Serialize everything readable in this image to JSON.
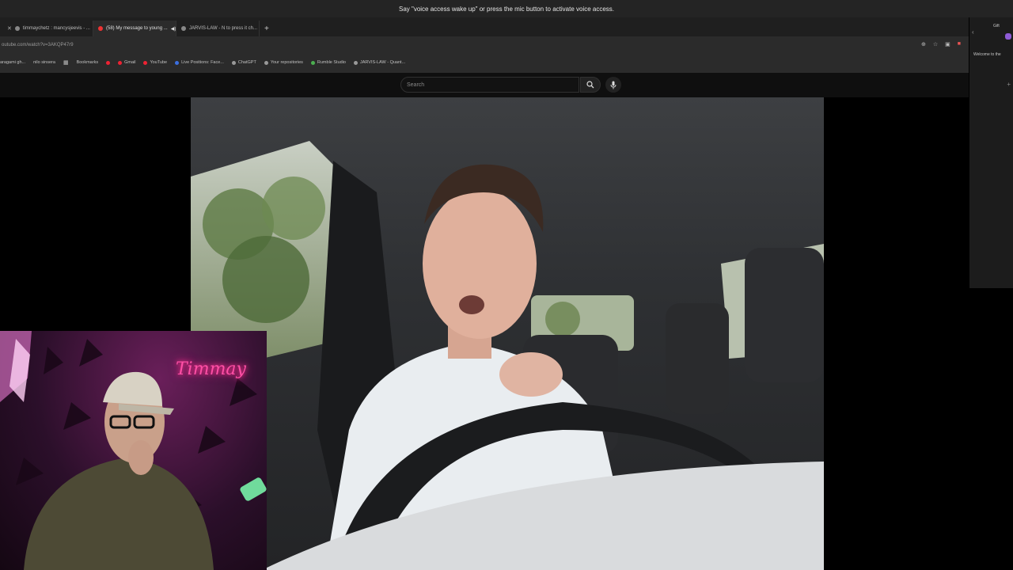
{
  "voice_access": {
    "message": "Say \"voice access wake up\" or press the mic button to activate voice access."
  },
  "tabs": [
    {
      "label": "timmaychetz : mancysjeevis - ..."
    },
    {
      "label": "(58) My message to young ...",
      "active": true
    },
    {
      "label": "JARVIS-LAW - N to press it ch..."
    }
  ],
  "omnibox": {
    "url": "outube.com/watch?v=3AKQP47r9"
  },
  "bookmarks": [
    {
      "label": "aragami gh..."
    },
    {
      "label": "nilo sinsera"
    },
    {
      "label": "Bookmarks"
    },
    {
      "label": "Gmail"
    },
    {
      "label": "YouTube"
    },
    {
      "label": "Live Positions: Face..."
    },
    {
      "label": "ChatGPT"
    },
    {
      "label": "Your repositories"
    },
    {
      "label": "Rumble Studio"
    },
    {
      "label": "JARVIS-LAW - Quant..."
    }
  ],
  "side_panel": {
    "gift": "Gift",
    "welcome": "Welcome to the"
  },
  "youtube": {
    "search_placeholder": "Search"
  },
  "webcam": {
    "neon_sign": "Timmay"
  },
  "colors": {
    "chrome_bg": "#2b2b2b",
    "tab_strip": "#1f1f1f",
    "youtube_bg": "#0f0f0f",
    "neon_pink": "#ff4fa6"
  }
}
